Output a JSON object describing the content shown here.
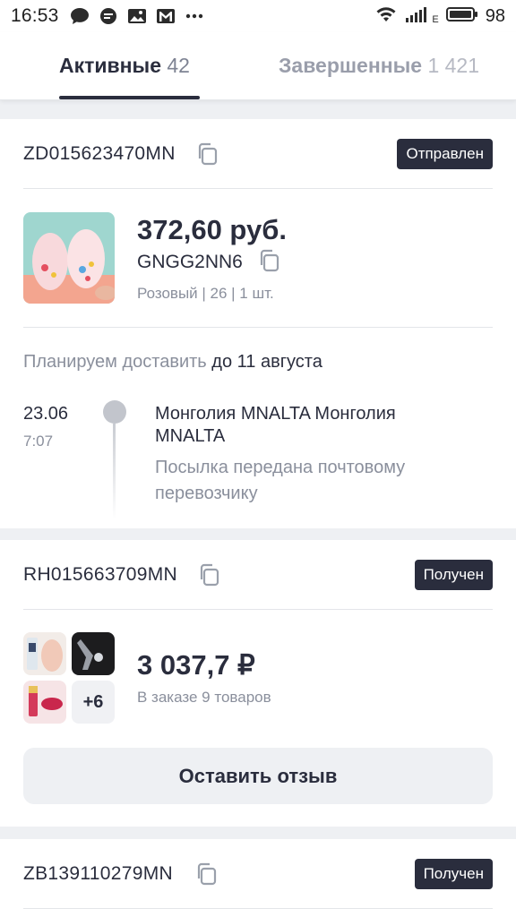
{
  "status_bar": {
    "time": "16:53",
    "battery": "98",
    "network_label": "E",
    "icons": [
      "chat-bubble-icon",
      "message-icon",
      "image-icon",
      "gmail-icon",
      "more-dots-icon",
      "wifi-icon",
      "signal-icon",
      "battery-icon"
    ]
  },
  "tabs": [
    {
      "label": "Активные",
      "count": "42",
      "active": true
    },
    {
      "label": "Завершенные",
      "count": "1 421",
      "active": false
    }
  ],
  "orders": [
    {
      "id": "ZD015623470MN",
      "status": "Отправлен",
      "price": "372,60 руб.",
      "sku": "GNGG2NN6",
      "details": "Розовый | 26 | 1 шт.",
      "plan_prefix": "Планируем доставить",
      "plan_date": "до 11 августа",
      "tracking": {
        "date": "23.06",
        "time": "7:07",
        "title": "Монголия MNALTA Монголия MNALTA",
        "description": "Посылка передана почтовому перевозчику"
      }
    },
    {
      "id": "RH015663709MN",
      "status": "Получен",
      "price": "3 037,7 ₽",
      "items_text": "В заказе 9 товаров",
      "more_count": "+6",
      "review_button": "Оставить отзыв"
    },
    {
      "id": "ZB139110279MN",
      "status": "Получен"
    }
  ],
  "colors": {
    "primary_dark": "#2a2d3d",
    "muted": "#8a8f9c",
    "page_bg": "#eef0f3"
  }
}
